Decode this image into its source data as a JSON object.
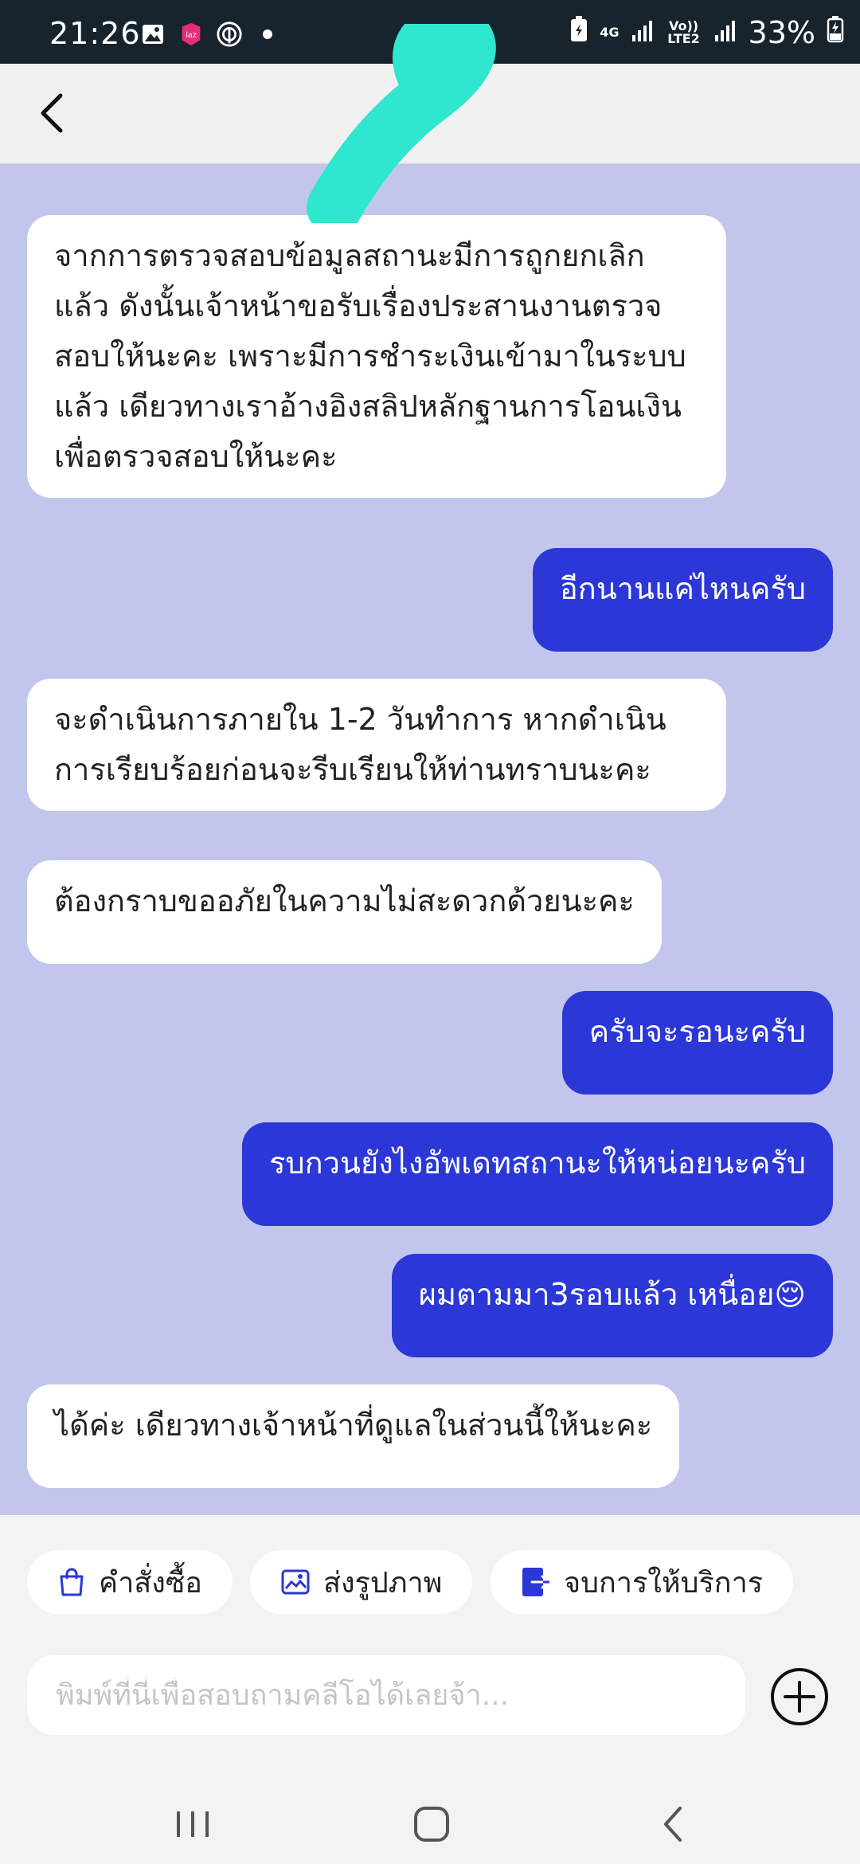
{
  "status_bar": {
    "time": "21:26",
    "network": "4G",
    "volte": "Vo)) LTE2",
    "battery": "33%",
    "left_icons": [
      "image-icon",
      "lazada-icon",
      "at-icon",
      "dot-icon"
    ],
    "right_icons": [
      "battery-saver-icon",
      "signal-icon",
      "signal-icon",
      "battery-icon"
    ]
  },
  "header": {
    "back_icon": "chevron-left-icon"
  },
  "messages": [
    {
      "side": "incoming",
      "text": "จากการตรวจสอบข้อมูลสถานะมีการถูกยกเลิกแล้ว ดังนั้นเจ้าหน้าขอรับเรื่องประสานงานตรวจสอบให้นะคะ เพราะมีการชำระเงินเข้ามาในระบบแล้ว เดียวทางเราอ้างอิงสลิปหลักฐานการโอนเงินเพื่อตรวจสอบให้นะคะ"
    },
    {
      "side": "outgoing",
      "text": "อีกนานแค่ไหนครับ"
    },
    {
      "side": "incoming",
      "text": "จะดำเนินการภายใน 1-2 วันทำการ หากดำเนินการเรียบร้อยก่อนจะรีบเรียนให้ท่านทราบนะคะ"
    },
    {
      "side": "incoming",
      "text": "ต้องกราบขออภัยในความไม่สะดวกด้วยนะคะ"
    },
    {
      "side": "outgoing",
      "text": "ครับจะรอนะครับ"
    },
    {
      "side": "outgoing",
      "text": "รบกวนยังไงอัพเดทสถานะให้หน่อยนะครับ"
    },
    {
      "side": "outgoing",
      "text": "ผมตามมา3รอบแล้ว เหนื่อย😌"
    },
    {
      "side": "incoming",
      "text": "ได้ค่ะ เดียวทางเจ้าหน้าที่ดูแลในส่วนนี้ให้นะคะ"
    }
  ],
  "quick_actions": [
    {
      "label": "คำสั่งซื้อ",
      "icon": "shopping-bag-icon"
    },
    {
      "label": "ส่งรูปภาพ",
      "icon": "image-icon"
    },
    {
      "label": "จบการให้บริการ",
      "icon": "exit-icon"
    }
  ],
  "composer": {
    "placeholder": "พิมพ์ที่นี่เพื่อสอบถามคลีโอได้เลยจ้า...",
    "value": "",
    "add_icon": "plus-circle-icon"
  },
  "nav_bar": {
    "icons": [
      "recent-apps-icon",
      "home-icon",
      "back-icon"
    ]
  },
  "colors": {
    "chat_background": "#c3c6ec",
    "outgoing_bubble": "#2b37d6",
    "incoming_bubble": "#ffffff",
    "status_bar": "#17232d",
    "redaction": "#2fe6cf"
  }
}
